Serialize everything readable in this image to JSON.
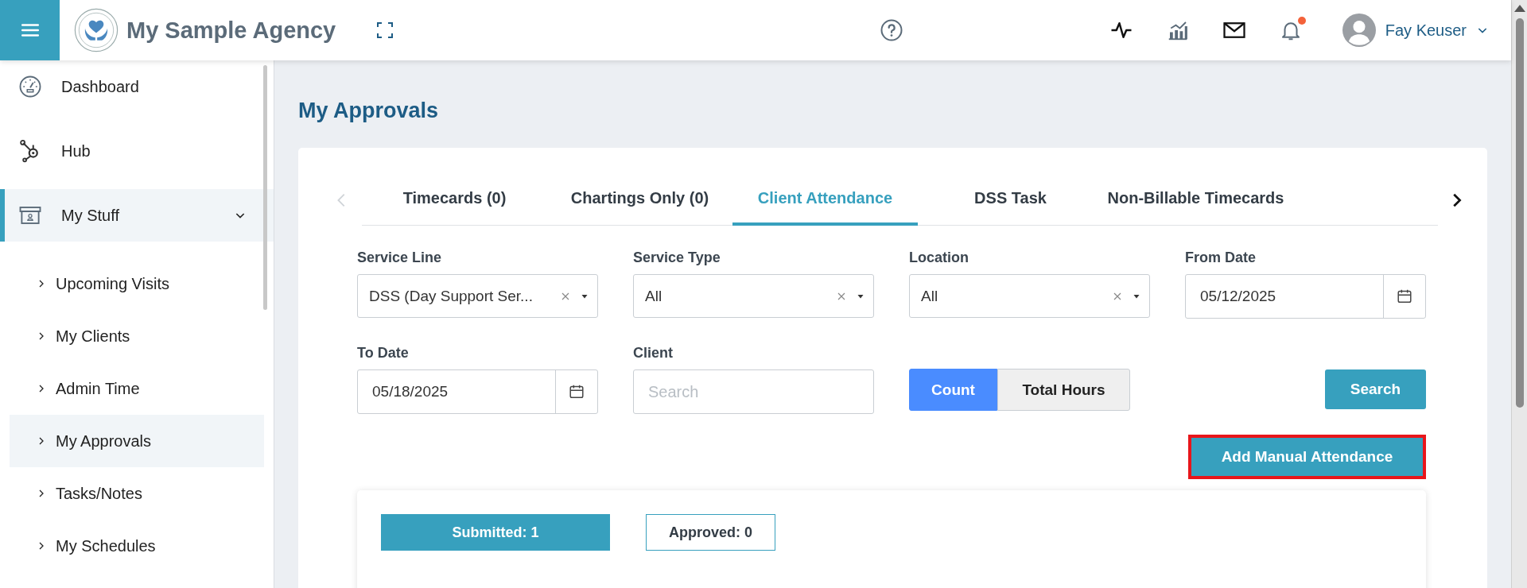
{
  "topbar": {
    "title": "My Sample Agency",
    "user_name": "Fay Keuser",
    "notification_dot": true
  },
  "sidebar": {
    "items": [
      {
        "label": "Dashboard",
        "kind": "gauge",
        "selected": false
      },
      {
        "label": "Hub",
        "kind": "hub",
        "selected": false
      },
      {
        "label": "My Stuff",
        "kind": "box",
        "selected": true,
        "expanded": true,
        "children": [
          {
            "label": "Upcoming Visits",
            "selected": false
          },
          {
            "label": "My Clients",
            "selected": false
          },
          {
            "label": "Admin Time",
            "selected": false
          },
          {
            "label": "My Approvals",
            "selected": true
          },
          {
            "label": "Tasks/Notes",
            "selected": false
          },
          {
            "label": "My Schedules",
            "selected": false
          }
        ]
      }
    ]
  },
  "page": {
    "title": "My Approvals"
  },
  "tab_scroll": {
    "prev_disabled": true,
    "next_disabled": false
  },
  "tabs": [
    {
      "label": "Timecards (0)",
      "selected": false
    },
    {
      "label": "Chartings Only (0)",
      "selected": false
    },
    {
      "label": "Client Attendance",
      "selected": true
    },
    {
      "label": "DSS Task",
      "selected": false
    },
    {
      "label": "Non-Billable Timecards",
      "selected": false
    }
  ],
  "filters": [
    {
      "label": "Service Line",
      "kind": "select",
      "value": "DSS (Day Support Ser..."
    },
    {
      "label": "Service Type",
      "kind": "select",
      "value": "All"
    },
    {
      "label": "Location",
      "kind": "select",
      "value": "All"
    },
    {
      "label": "From Date",
      "kind": "date",
      "value": "05/12/2025"
    },
    {
      "label": "To Date",
      "kind": "date",
      "value": "05/18/2025"
    },
    {
      "label": "Client",
      "kind": "text",
      "placeholder": "Search"
    }
  ],
  "toggle": [
    {
      "label": "Count",
      "selected": true
    },
    {
      "label": "Total Hours",
      "selected": false
    }
  ],
  "search_button": "Search",
  "add_button": {
    "label": "Add Manual Attendance",
    "highlighted": true
  },
  "status_tabs": [
    {
      "label": "Submitted: 1",
      "selected": true
    },
    {
      "label": "Approved: 0",
      "selected": false
    }
  ]
}
